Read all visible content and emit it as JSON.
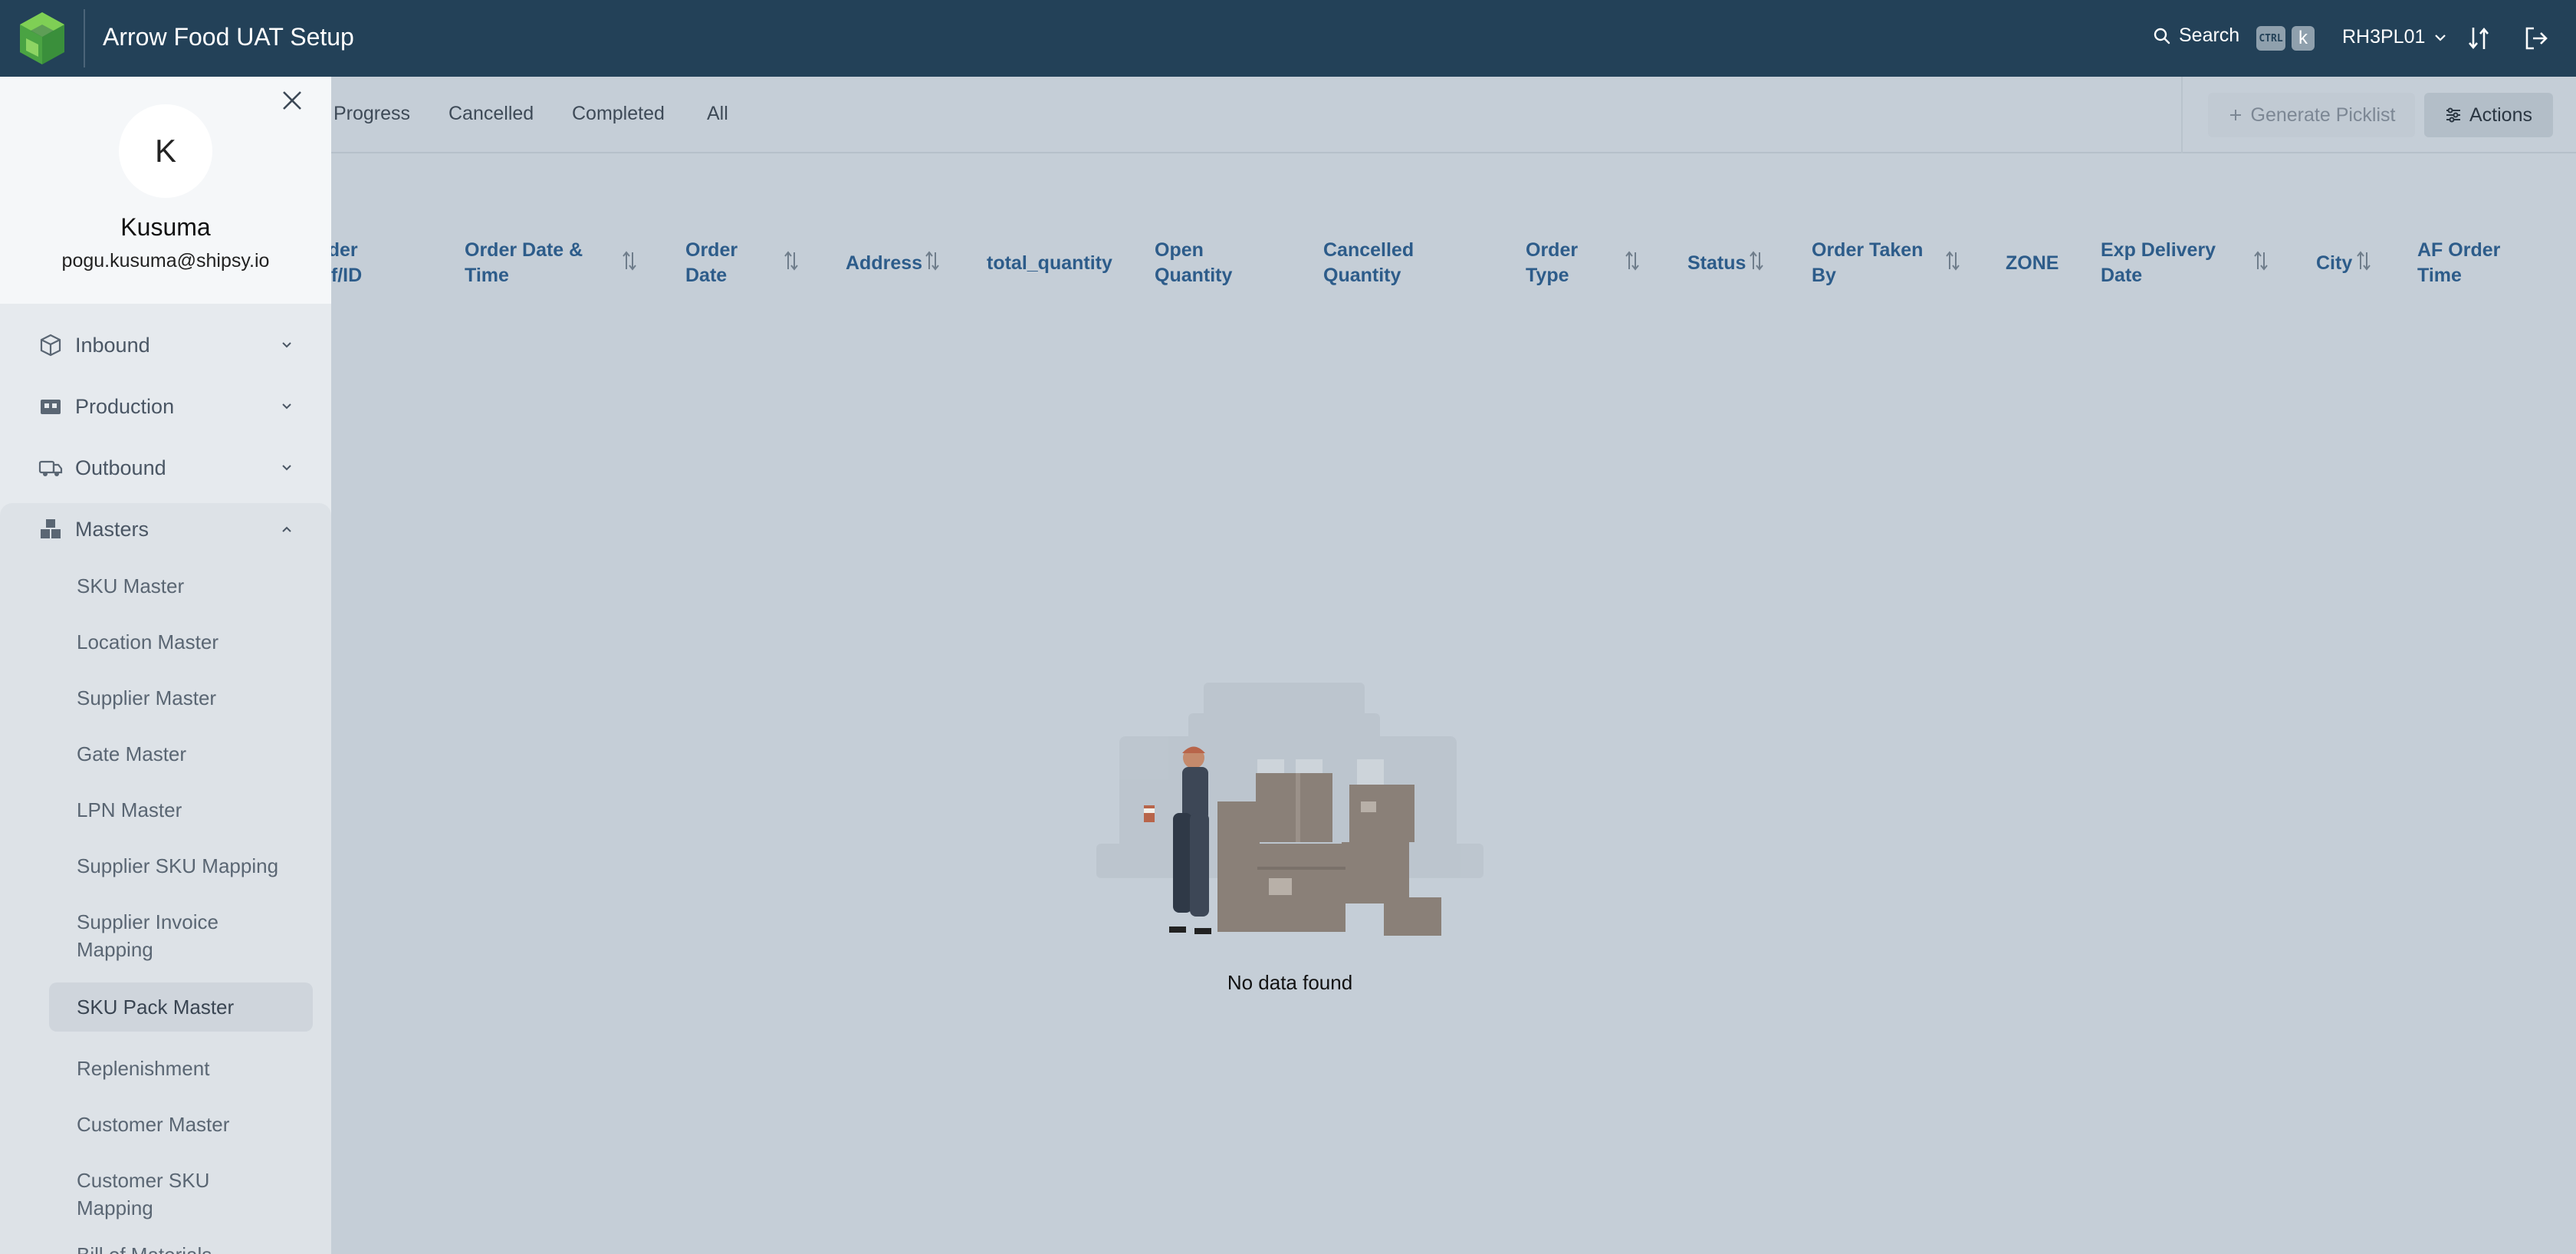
{
  "header": {
    "app_title": "Arrow Food UAT Setup",
    "search_label": "Search",
    "kbd_ctrl": "CTRL",
    "kbd_k": "k",
    "warehouse": "RH3PL01"
  },
  "tabs": [
    {
      "label": "Progress"
    },
    {
      "label": "Cancelled"
    },
    {
      "label": "Completed"
    },
    {
      "label": "All"
    }
  ],
  "toolbar": {
    "generate_picklist": "Generate Picklist",
    "actions": "Actions"
  },
  "table": {
    "columns": [
      {
        "line1": "rder",
        "line2": "ef/ID"
      },
      {
        "line1": "Order Date &",
        "line2": "Time"
      },
      {
        "line1": "Order",
        "line2": "Date"
      },
      {
        "line1": "Address",
        "line2": ""
      },
      {
        "line1": "total_quantity",
        "line2": ""
      },
      {
        "line1": "Open",
        "line2": "Quantity"
      },
      {
        "line1": "Cancelled",
        "line2": "Quantity"
      },
      {
        "line1": "Order",
        "line2": "Type"
      },
      {
        "line1": "Status",
        "line2": ""
      },
      {
        "line1": "Order Taken",
        "line2": "By"
      },
      {
        "line1": "ZONE",
        "line2": ""
      },
      {
        "line1": "Exp Delivery",
        "line2": "Date"
      },
      {
        "line1": "City",
        "line2": ""
      },
      {
        "line1": "AF Order",
        "line2": "Time"
      }
    ],
    "empty_text": "No data found"
  },
  "drawer": {
    "avatar_letter": "K",
    "user_name": "Kusuma",
    "user_email": "pogu.kusuma@shipsy.io",
    "groups": [
      {
        "label": "Inbound",
        "icon": "box-icon"
      },
      {
        "label": "Production",
        "icon": "factory-icon"
      },
      {
        "label": "Outbound",
        "icon": "truck-icon"
      },
      {
        "label": "Masters",
        "icon": "boxes-icon"
      }
    ],
    "masters_items": [
      {
        "l1": "SKU Master",
        "l2": ""
      },
      {
        "l1": "Location Master",
        "l2": ""
      },
      {
        "l1": "Supplier Master",
        "l2": ""
      },
      {
        "l1": "Gate Master",
        "l2": ""
      },
      {
        "l1": "LPN Master",
        "l2": ""
      },
      {
        "l1": "Supplier SKU Mapping",
        "l2": ""
      },
      {
        "l1": "Supplier Invoice",
        "l2": "Mapping"
      },
      {
        "l1": "SKU Pack Master",
        "l2": ""
      },
      {
        "l1": "Replenishment",
        "l2": ""
      },
      {
        "l1": "Customer Master",
        "l2": ""
      },
      {
        "l1": "Customer SKU",
        "l2": "Mapping"
      },
      {
        "l1": "Bill of Materials",
        "l2": ""
      }
    ]
  },
  "colors": {
    "topbar": "#234158",
    "overlay": "#c5ced7",
    "header_text": "#2d5c8a",
    "logo_green": "#5cb54a"
  }
}
